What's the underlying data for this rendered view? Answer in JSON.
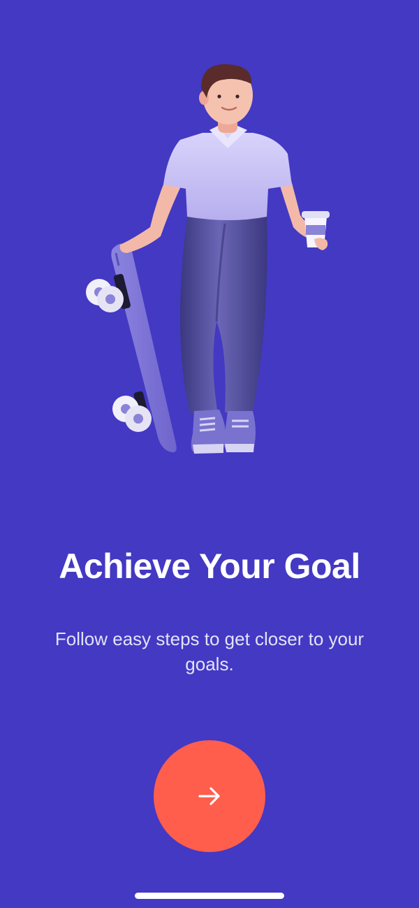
{
  "onboarding": {
    "title": "Achieve Your Goal",
    "subtitle": "Follow easy steps to get closer to your goals."
  },
  "next_button": {
    "icon": "arrow-right-icon"
  },
  "illustration": {
    "subject": "person-with-skateboard-and-coffee"
  },
  "colors": {
    "background": "#4339C3",
    "button": "#FF5E4D",
    "title": "#FFFFFF",
    "subtitle": "#E4E2F7",
    "home_indicator": "#FFFFFF"
  }
}
